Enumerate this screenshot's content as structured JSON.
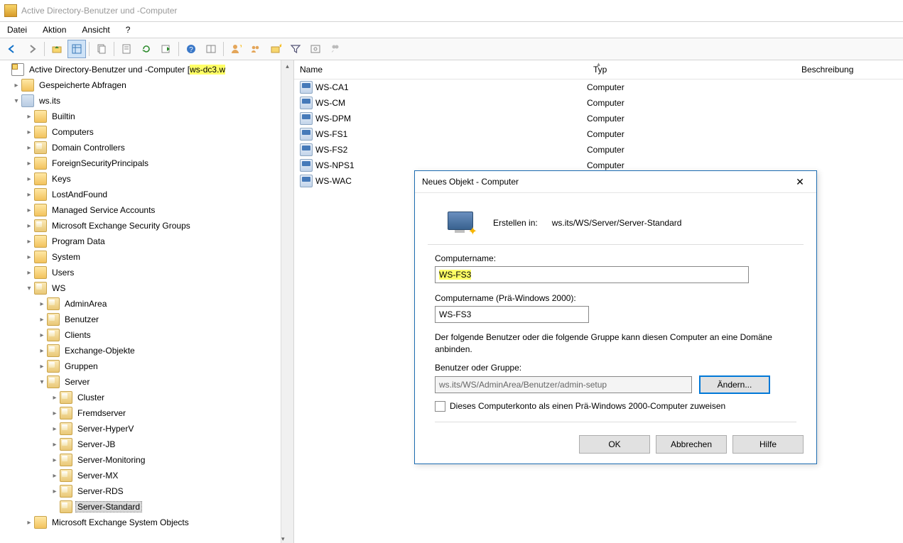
{
  "window": {
    "title": "Active Directory-Benutzer und -Computer"
  },
  "menu": {
    "datei": "Datei",
    "aktion": "Aktion",
    "ansicht": "Ansicht",
    "help": "?"
  },
  "tree": {
    "root_prefix": "Active Directory-Benutzer und -Computer [",
    "root_host": "ws-dc3.w",
    "items": {
      "queries": "Gespeicherte Abfragen",
      "domain": "ws.its",
      "builtin": "Builtin",
      "computers": "Computers",
      "dc": "Domain Controllers",
      "fsp": "ForeignSecurityPrincipals",
      "keys": "Keys",
      "laf": "LostAndFound",
      "msa": "Managed Service Accounts",
      "mesg": "Microsoft Exchange Security Groups",
      "pd": "Program Data",
      "system": "System",
      "users": "Users",
      "ws": "WS",
      "adminarea": "AdminArea",
      "benutzer": "Benutzer",
      "clients": "Clients",
      "exobj": "Exchange-Objekte",
      "gruppen": "Gruppen",
      "server": "Server",
      "cluster": "Cluster",
      "fremd": "Fremdserver",
      "hyperv": "Server-HyperV",
      "jb": "Server-JB",
      "monitoring": "Server-Monitoring",
      "mx": "Server-MX",
      "rds": "Server-RDS",
      "standard": "Server-Standard",
      "meso": "Microsoft Exchange System Objects"
    }
  },
  "list": {
    "headers": {
      "name": "Name",
      "type": "Typ",
      "desc": "Beschreibung"
    },
    "type_label": "Computer",
    "rows": [
      "WS-CA1",
      "WS-CM",
      "WS-DPM",
      "WS-FS1",
      "WS-FS2",
      "WS-NPS1",
      "WS-WAC"
    ]
  },
  "dialog": {
    "title": "Neues Objekt - Computer",
    "create_in_label": "Erstellen in:",
    "create_in_path": "ws.its/WS/Server/Server-Standard",
    "name_label": "Computername:",
    "name_value": "WS-FS3",
    "prewin_label": "Computername (Prä-Windows 2000):",
    "prewin_value": "WS-FS3",
    "info_text": "Der folgende Benutzer oder die folgende Gruppe kann diesen Computer an eine Domäne anbinden.",
    "usergroup_label": "Benutzer oder Gruppe:",
    "usergroup_value": "ws.its/WS/AdminArea/Benutzer/admin-setup",
    "change_btn": "Ändern...",
    "checkbox_label": "Dieses Computerkonto als einen Prä-Windows 2000-Computer zuweisen",
    "ok": "OK",
    "cancel": "Abbrechen",
    "help": "Hilfe"
  }
}
